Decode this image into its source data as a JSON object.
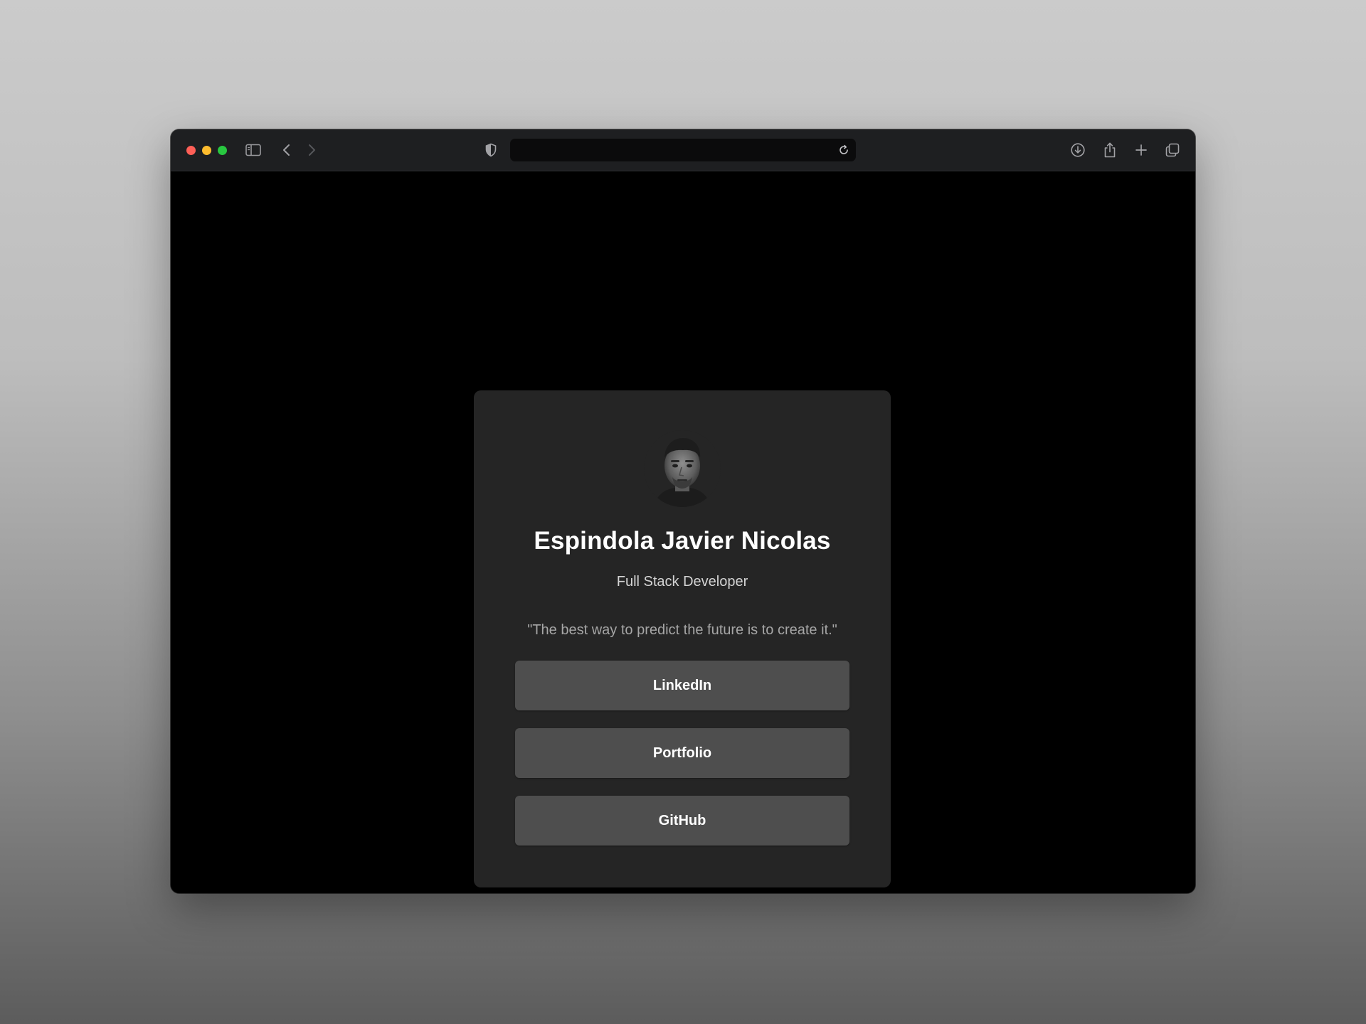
{
  "browser": {
    "address_value": "",
    "icons": {
      "sidebar": "sidebar-toggle-icon",
      "back": "chevron-left-icon",
      "forward": "chevron-right-icon",
      "privacy": "shield-icon",
      "reload": "reload-icon",
      "download": "download-icon",
      "share": "share-icon",
      "new_tab": "plus-icon",
      "tabs": "tab-overview-icon"
    },
    "traffic_lights": {
      "close": "#ff5f57",
      "minimize": "#febc2e",
      "zoom": "#28c840"
    }
  },
  "profile": {
    "name": "Espindola Javier Nicolas",
    "role": "Full Stack Developer",
    "quote": "\"The best way to predict the future is to create it.\"",
    "links": [
      {
        "label": "LinkedIn"
      },
      {
        "label": "Portfolio"
      },
      {
        "label": "GitHub"
      }
    ]
  },
  "colors": {
    "page_background": "#000000",
    "card_background": "#252525",
    "button_background": "#4e4e4e",
    "title_text": "#ffffff",
    "quote_text": "#a6a6a6"
  }
}
